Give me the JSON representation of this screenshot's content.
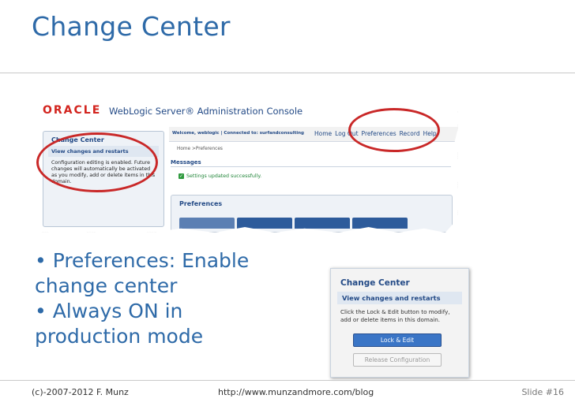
{
  "slide": {
    "title": "Change Center",
    "bullets": [
      "• Preferences: Enable change center",
      "• Always ON in production mode"
    ]
  },
  "console_screenshot": {
    "brand": "ORACLE",
    "app_title": "WebLogic Server® Administration Console",
    "change_center": {
      "heading": "Change Center",
      "link": "View changes and restarts",
      "text": "Configuration editing is enabled. Future changes will automatically be activated as you modify, add or delete items in this domain."
    },
    "top_bar": {
      "welcome": "Welcome, weblogic | Connected to: surfandconsulting",
      "nav": [
        "Home",
        "Log Out",
        "Preferences",
        "Record",
        "Help"
      ]
    },
    "breadcrumb": "Home >Preferences",
    "messages_label": "Messages",
    "success_message": "Settings updated successfully.",
    "preferences_heading": "Preferences"
  },
  "small_screenshot": {
    "heading": "Change Center",
    "link": "View changes and restarts",
    "text": "Click the Lock & Edit button to modify, add or delete items in this domain.",
    "lock_button": "Lock & Edit",
    "release_button": "Release Configuration"
  },
  "footer": {
    "left": "(c)-2007-2012 F. Munz",
    "center": "http://www.munzandmore.com/blog",
    "right": "Slide #16"
  },
  "colors": {
    "title": "#2e6aa8",
    "oracle_red": "#d3251f",
    "highlight_circle": "#c92828",
    "button_blue": "#3a75c6"
  }
}
